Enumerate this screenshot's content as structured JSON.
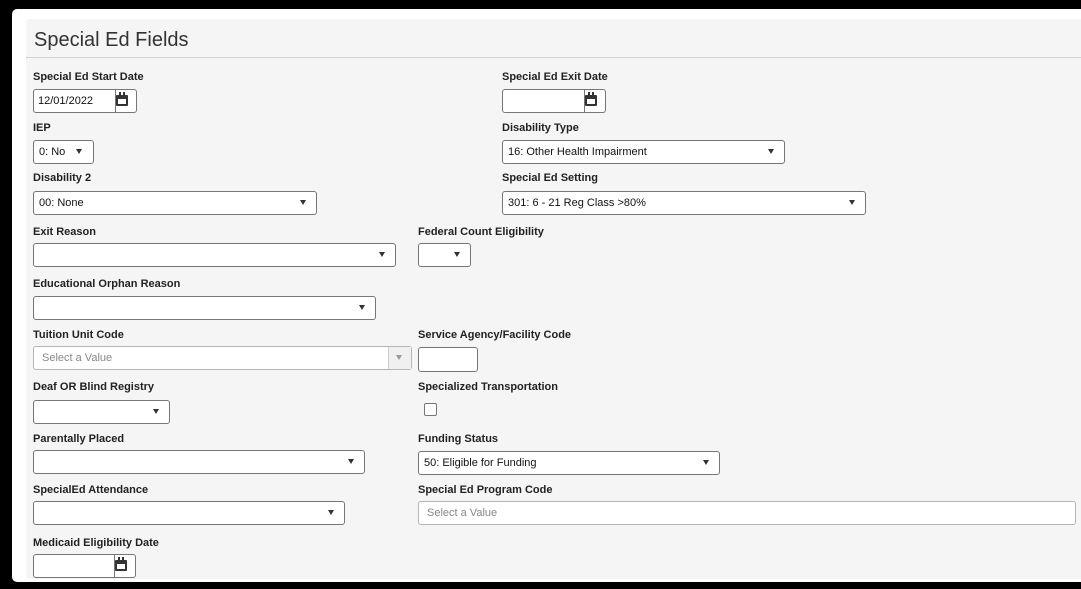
{
  "section": {
    "title": "Special Ed Fields"
  },
  "fields": {
    "start_date": {
      "label": "Special Ed Start Date",
      "value": "12/01/2022"
    },
    "exit_date": {
      "label": "Special Ed Exit Date",
      "value": ""
    },
    "iep": {
      "label": "IEP",
      "value": "0: No"
    },
    "disability_type": {
      "label": "Disability Type",
      "value": "16: Other Health Impairment"
    },
    "disability_2": {
      "label": "Disability 2",
      "value": "00: None"
    },
    "setting": {
      "label": "Special Ed Setting",
      "value": "301: 6 - 21 Reg Class >80%"
    },
    "exit_reason": {
      "label": "Exit Reason",
      "value": ""
    },
    "federal_count": {
      "label": "Federal Count Eligibility",
      "value": ""
    },
    "orphan_reason": {
      "label": "Educational Orphan Reason",
      "value": ""
    },
    "tuition_unit": {
      "label": "Tuition Unit Code",
      "placeholder": "Select a Value"
    },
    "service_agency": {
      "label": "Service Agency/Facility Code",
      "value": ""
    },
    "deaf_blind": {
      "label": "Deaf OR Blind Registry",
      "value": ""
    },
    "transportation": {
      "label": "Specialized Transportation",
      "checked": false
    },
    "parentally_placed": {
      "label": "Parentally Placed",
      "value": ""
    },
    "funding_status": {
      "label": "Funding Status",
      "value": "50: Eligible for Funding"
    },
    "attendance": {
      "label": "SpecialEd Attendance",
      "value": ""
    },
    "program_code": {
      "label": "Special Ed Program Code",
      "placeholder": "Select a Value"
    },
    "medicaid_date": {
      "label": "Medicaid Eligibility Date",
      "value": ""
    }
  }
}
